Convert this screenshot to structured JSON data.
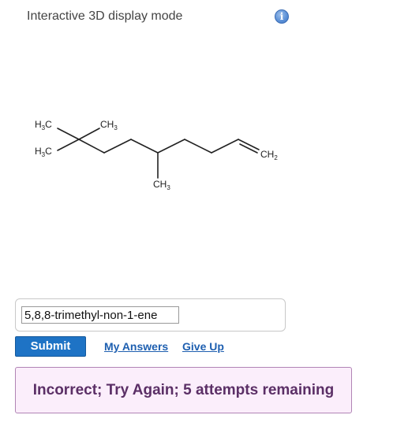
{
  "header": {
    "title": "Interactive 3D display mode",
    "info_icon": "info-icon",
    "info_glyph": "i"
  },
  "molecule": {
    "labels": {
      "h3c_top": {
        "main": "H",
        "sub": "3",
        "tail": "C"
      },
      "ch3_top": {
        "main": "CH",
        "sub": "3"
      },
      "h3c_bottom": {
        "main": "H",
        "sub": "3",
        "tail": "C"
      },
      "ch3_bottom": {
        "main": "CH",
        "sub": "3"
      },
      "ch2_right": {
        "main": "CH",
        "sub": "2"
      }
    }
  },
  "answer": {
    "value": "5,8,8-trimethyl-non-1-ene"
  },
  "actions": {
    "submit_label": "Submit",
    "my_answers_label": "My Answers",
    "give_up_label": "Give Up"
  },
  "feedback": {
    "message": "Incorrect; Try Again; 5 attempts remaining"
  }
}
